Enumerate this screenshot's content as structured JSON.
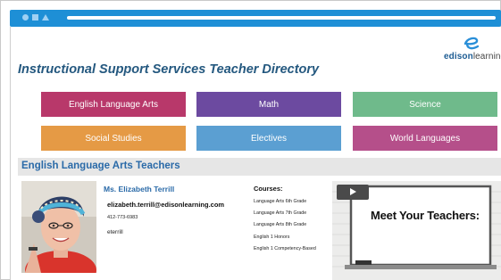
{
  "page": {
    "title": "Instructional Support Services Teacher Directory"
  },
  "logo": {
    "brand_bold": "edison",
    "brand_rest": "learning",
    "brand_color": "#1d5c93"
  },
  "subjects": [
    {
      "label": "English Language Arts",
      "color": "#b8386a"
    },
    {
      "label": "Math",
      "color": "#6c4aa0"
    },
    {
      "label": "Science",
      "color": "#6fba8b"
    },
    {
      "label": "Social Studies",
      "color": "#e59a45"
    },
    {
      "label": "Electives",
      "color": "#5b9fd2"
    },
    {
      "label": "World Languages",
      "color": "#b54f8a"
    }
  ],
  "section": {
    "title": "English Language Arts Teachers"
  },
  "teacher": {
    "name": "Ms. Elizabeth Terrill",
    "email": "elizabeth.terrill@edisonlearning.com",
    "phone": "412-773-6983",
    "username": "eterrill",
    "courses_heading": "Courses:",
    "courses": [
      "Language Arts 6th Grade",
      "Language Arts 7th Grade",
      "Language Arts 8th Grade",
      "English 1 Honors",
      "English 1 Competency-Based"
    ]
  },
  "video": {
    "title": "Meet Your Teachers:",
    "play_icon": "play-icon"
  },
  "colors": {
    "browser_bar": "#1e8fd6",
    "title_color": "#24587f",
    "link_color": "#2a6aa8"
  }
}
